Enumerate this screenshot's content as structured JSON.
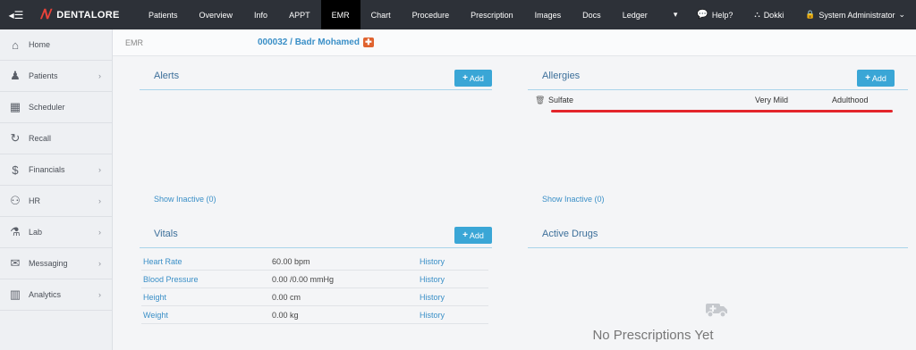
{
  "brand": {
    "name": "DENTALORE"
  },
  "nav": {
    "tabs": [
      "Patients",
      "Overview",
      "Info",
      "APPT",
      "EMR",
      "Chart",
      "Procedure",
      "Prescription",
      "Images",
      "Docs",
      "Ledger"
    ],
    "active": "EMR",
    "help": "Help?",
    "clinic": "Dokki",
    "user": "System Administrator"
  },
  "sidebar": {
    "items": [
      {
        "label": "Home",
        "icon": "home-icon",
        "chevron": false
      },
      {
        "label": "Patients",
        "icon": "patient-icon",
        "chevron": true
      },
      {
        "label": "Scheduler",
        "icon": "calendar-icon",
        "chevron": false
      },
      {
        "label": "Recall",
        "icon": "recall-icon",
        "chevron": false
      },
      {
        "label": "Financials",
        "icon": "dollar-icon",
        "chevron": true
      },
      {
        "label": "HR",
        "icon": "users-icon",
        "chevron": true
      },
      {
        "label": "Lab",
        "icon": "flask-icon",
        "chevron": true
      },
      {
        "label": "Messaging",
        "icon": "envelope-icon",
        "chevron": true
      },
      {
        "label": "Analytics",
        "icon": "bar-chart-icon",
        "chevron": true
      }
    ]
  },
  "header": {
    "crumb": "EMR",
    "patient": "000032 / Badr Mohamed"
  },
  "alerts": {
    "title": "Alerts",
    "add": "Add",
    "show_inactive": "Show Inactive (0)"
  },
  "allergies": {
    "title": "Allergies",
    "add": "Add",
    "show_inactive": "Show Inactive (0)",
    "rows": [
      {
        "name": "Sulfate",
        "severity": "Very Mild",
        "onset": "Adulthood"
      }
    ]
  },
  "vitals": {
    "title": "Vitals",
    "add": "Add",
    "rows": [
      {
        "name": "Heart Rate",
        "value": "60.00 bpm",
        "link": "History"
      },
      {
        "name": "Blood Pressure",
        "value": "0.00 /0.00 mmHg",
        "link": "History"
      },
      {
        "name": "Height",
        "value": "0.00 cm",
        "link": "History"
      },
      {
        "name": "Weight",
        "value": "0.00 kg",
        "link": "History"
      }
    ]
  },
  "active_drugs": {
    "title": "Active Drugs",
    "empty": "No Prescriptions Yet"
  },
  "colors": {
    "accent": "#3aa6d6",
    "nav_bg": "#2d3138",
    "highlight": "#e3252b",
    "brand": "#e8423a"
  }
}
